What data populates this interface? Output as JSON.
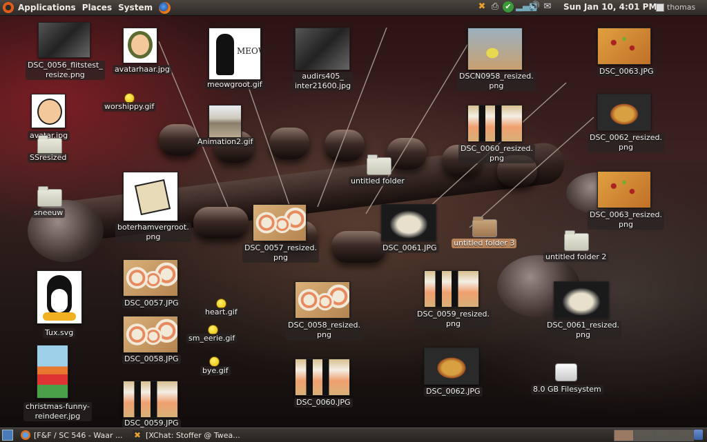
{
  "top_panel": {
    "menus": [
      "Applications",
      "Places",
      "System"
    ],
    "clock": "Sun Jan 10,  4:01 PM",
    "user": "thomas"
  },
  "desktop": {
    "icons": [
      {
        "label": "DSC_0056_flitstest_\nresize.png",
        "icon": "image-thumbnail"
      },
      {
        "label": "avatarhaar.jpg",
        "icon": "image-thumbnail"
      },
      {
        "label": "meowgroot.gif",
        "icon": "image-thumbnail"
      },
      {
        "label": "audirs405_\ninter21600.jpg",
        "icon": "image-thumbnail"
      },
      {
        "label": "DSCN0958_resized.\npng",
        "icon": "image-thumbnail"
      },
      {
        "label": "DSC_0063.JPG",
        "icon": "image-thumbnail"
      },
      {
        "label": "worshippy.gif",
        "icon": "smiley-icon"
      },
      {
        "label": "avatar.jpg",
        "icon": "image-thumbnail"
      },
      {
        "label": "SSresized",
        "icon": "folder-icon"
      },
      {
        "label": "Animation2.gif",
        "icon": "image-thumbnail"
      },
      {
        "label": "DSC_0060_resized.\npng",
        "icon": "image-thumbnail"
      },
      {
        "label": "DSC_0062_resized.\npng",
        "icon": "image-thumbnail"
      },
      {
        "label": "untitled folder",
        "icon": "folder-icon"
      },
      {
        "label": "sneeuw",
        "icon": "folder-icon"
      },
      {
        "label": "boterhamvergroot.\npng",
        "icon": "image-thumbnail"
      },
      {
        "label": "DSC_0057_resized.\npng",
        "icon": "image-thumbnail"
      },
      {
        "label": "DSC_0061.JPG",
        "icon": "image-thumbnail"
      },
      {
        "label": "untitled folder 3",
        "icon": "folder-icon"
      },
      {
        "label": "DSC_0063_resized.\npng",
        "icon": "image-thumbnail"
      },
      {
        "label": "untitled folder 2",
        "icon": "folder-icon"
      },
      {
        "label": "DSC_0057.JPG",
        "icon": "image-thumbnail"
      },
      {
        "label": "Tux.svg",
        "icon": "image-thumbnail"
      },
      {
        "label": "heart.gif",
        "icon": "smiley-icon"
      },
      {
        "label": "DSC_0058_resized.\npng",
        "icon": "image-thumbnail"
      },
      {
        "label": "DSC_0059_resized.\npng",
        "icon": "image-thumbnail"
      },
      {
        "label": "DSC_0061_resized.\npng",
        "icon": "image-thumbnail"
      },
      {
        "label": "DSC_0058.JPG",
        "icon": "image-thumbnail"
      },
      {
        "label": "sm_eerie.gif",
        "icon": "smiley-icon"
      },
      {
        "label": "christmas-funny-\nreindeer.jpg",
        "icon": "image-thumbnail"
      },
      {
        "label": "bye.gif",
        "icon": "smiley-icon"
      },
      {
        "label": "DSC_0060.JPG",
        "icon": "image-thumbnail"
      },
      {
        "label": "DSC_0062.JPG",
        "icon": "image-thumbnail"
      },
      {
        "label": "8.0 GB Filesystem",
        "icon": "drive-icon"
      },
      {
        "label": "DSC_0059.JPG",
        "icon": "image-thumbnail"
      }
    ]
  },
  "bottom_panel": {
    "tasks": [
      "[F&F / SC 546 - Waar ...",
      "[XChat: Stoffer @ Twea..."
    ]
  }
}
